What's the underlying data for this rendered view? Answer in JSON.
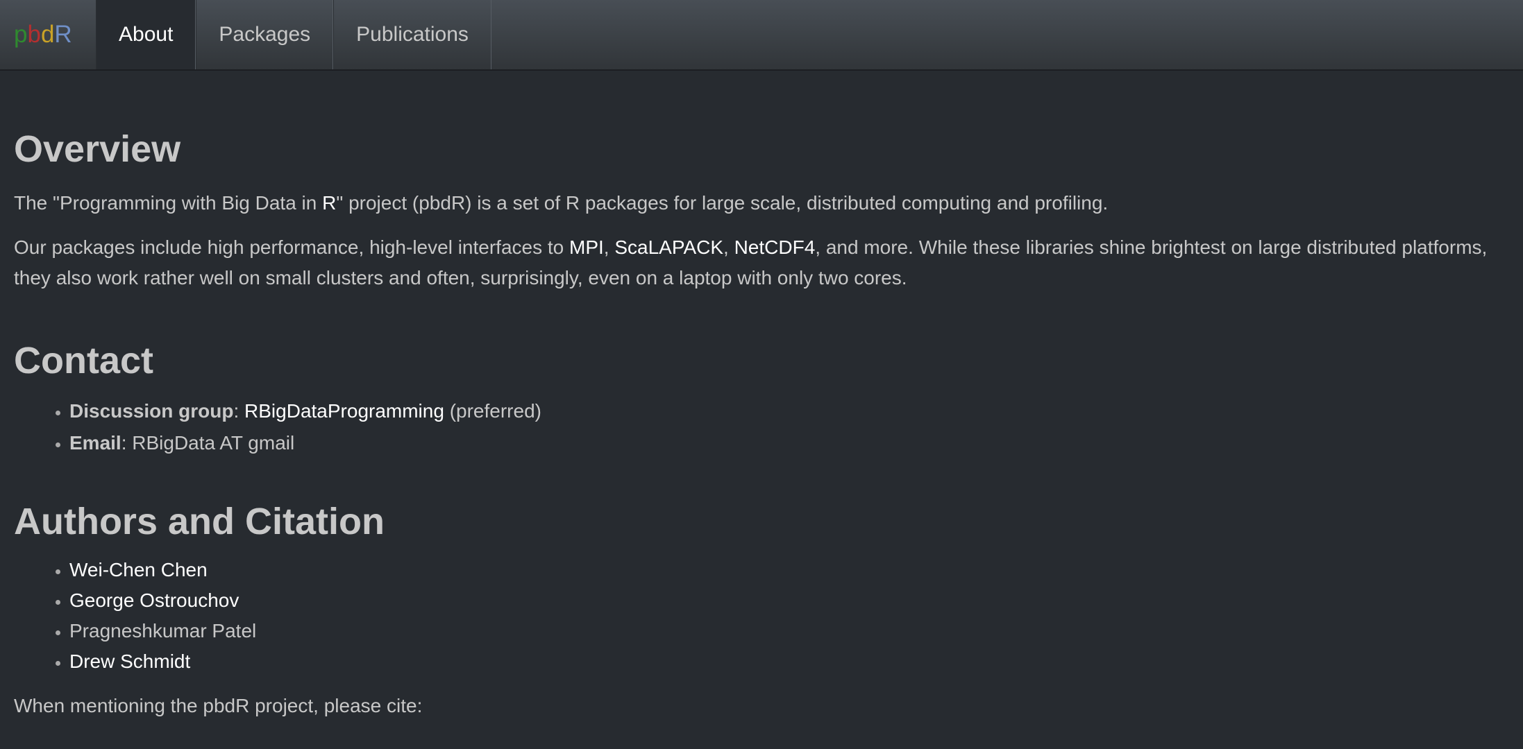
{
  "nav": {
    "brand": [
      "p",
      "b",
      "d",
      "R"
    ],
    "brand_colors": [
      "#2f8a2f",
      "#b42f2f",
      "#c9a227",
      "#6f8fc7"
    ],
    "items": [
      {
        "label": "About",
        "active": true
      },
      {
        "label": "Packages",
        "active": false
      },
      {
        "label": "Publications",
        "active": false
      }
    ]
  },
  "overview": {
    "heading": "Overview",
    "p1": {
      "pre": "The \"Programming with Big Data in ",
      "link": "R",
      "post": "\" project (pbdR) is a set of R packages for large scale, distributed computing and profiling."
    },
    "p2": {
      "pre": "Our packages include high performance, high-level interfaces to ",
      "links": [
        "MPI",
        "ScaLAPACK",
        "NetCDF4"
      ],
      "sep": ", ",
      "post": ", and more. While these libraries shine brightest on large distributed platforms, they also work rather well on small clusters and often, surprisingly, even on a laptop with only two cores."
    }
  },
  "contact": {
    "heading": "Contact",
    "items": [
      {
        "label": "Discussion group",
        "colon": ": ",
        "link": "RBigDataProgramming",
        "note": " (preferred)"
      },
      {
        "label": "Email",
        "colon": ": ",
        "text": "RBigData AT gmail"
      }
    ]
  },
  "authors": {
    "heading": "Authors and Citation",
    "list": [
      {
        "name": "Wei-Chen Chen",
        "link": true
      },
      {
        "name": "George Ostrouchov",
        "link": true
      },
      {
        "name": "Pragneshkumar Patel",
        "link": false
      },
      {
        "name": "Drew Schmidt",
        "link": true
      }
    ],
    "cite_text": "When mentioning the pbdR project, please cite:"
  },
  "colors": {
    "background": "#272b30",
    "text": "#c8c8c8",
    "link": "#ffffff",
    "navbar": "#3a3f44"
  }
}
